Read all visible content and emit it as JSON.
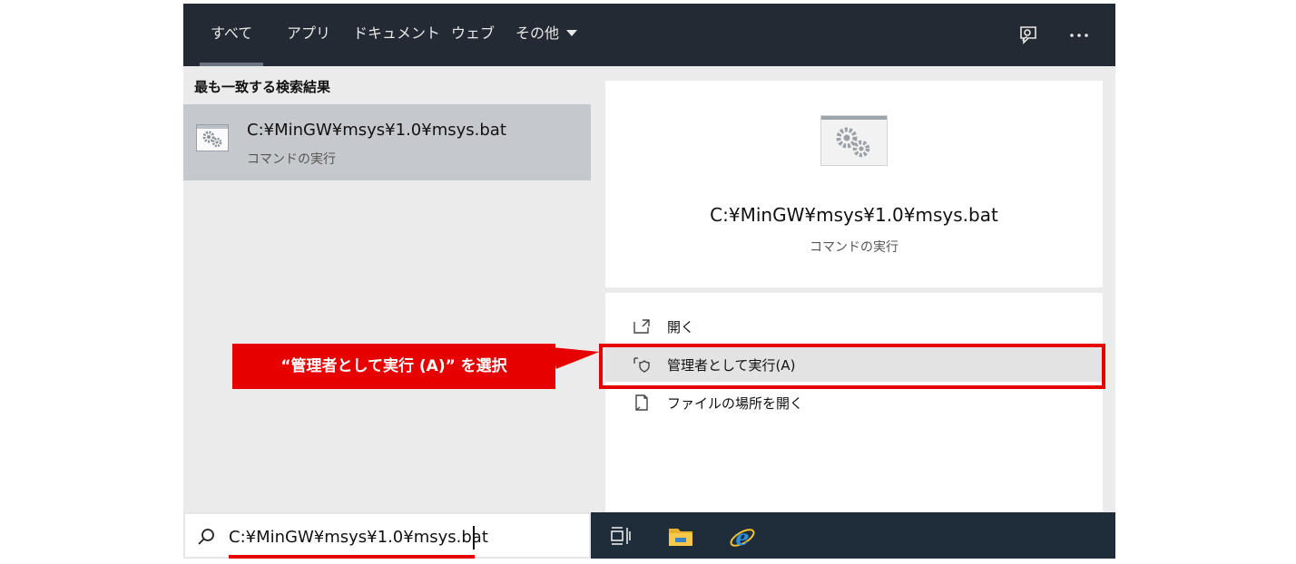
{
  "tabs": [
    {
      "label": "すべて",
      "active": true
    },
    {
      "label": "アプリ"
    },
    {
      "label": "ドキュメント"
    },
    {
      "label": "ウェブ"
    },
    {
      "label": "その他"
    }
  ],
  "topbar_icons": [
    "feedback-icon",
    "more-icon"
  ],
  "best_match": {
    "heading": "最も一致する検索結果",
    "item": {
      "title": "C:¥MinGW¥msys¥1.0¥msys.bat",
      "subtitle": "コマンドの実行",
      "icon": "settings-gears-icon"
    }
  },
  "detail": {
    "title": "C:¥MinGW¥msys¥1.0¥msys.bat",
    "subtitle": "コマンドの実行",
    "icon": "settings-gears-icon"
  },
  "actions": [
    {
      "label": "開く",
      "icon": "open-icon"
    },
    {
      "label": "管理者として実行(A)",
      "icon": "shield-icon",
      "highlighted": true
    },
    {
      "label": "ファイルの場所を開く",
      "icon": "file-location-icon"
    }
  ],
  "annotation": {
    "text": "“管理者として実行 (A)” を選択"
  },
  "search": {
    "value": "C:¥MinGW¥msys¥1.0¥msys.bat"
  },
  "taskbar_icons": [
    "task-view-icon",
    "file-explorer-icon",
    "internet-explorer-icon"
  ],
  "colors": {
    "accent_red": "#e60000",
    "topbar_bg": "#232a33",
    "taskbar_bg": "#1f2d3a",
    "selection_bg": "#c5c8cc"
  }
}
